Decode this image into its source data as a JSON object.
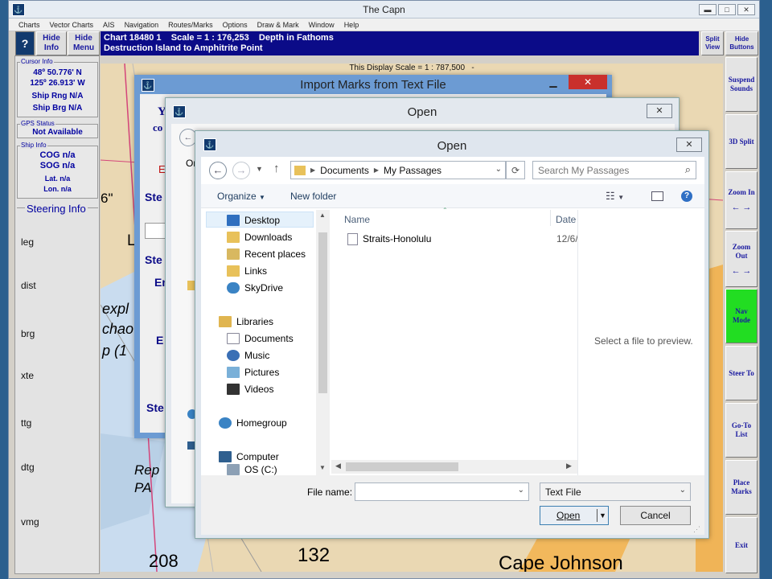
{
  "main_window": {
    "title": "The Capn",
    "menu": [
      "Charts",
      "Vector Charts",
      "AIS",
      "Navigation",
      "Routes/Marks",
      "Options",
      "Draw & Mark",
      "Window",
      "Help"
    ]
  },
  "toolbar": {
    "hide_info": "Hide Info",
    "hide_menu": "Hide Menu",
    "split_view": "Split View",
    "hide_buttons": "Hide Buttons"
  },
  "chart_info": {
    "line1": "Chart 18480 1    Scale = 1 : 176,253    Depth in Fathoms",
    "line2": "Destruction Island to Amphitrite Point"
  },
  "display_scale": "This Display Scale = 1 : 787,500   -",
  "cursor_info": {
    "caption": "Cursor Info",
    "lat": "48º 50.776' N",
    "lon": "125º 26.913' W",
    "ship_rng": "Ship Rng N/A",
    "ship_brg": "Ship Brg N/A"
  },
  "gps_status": {
    "caption": "GPS Status",
    "value": "Not Available"
  },
  "ship_info": {
    "caption": "Ship Info",
    "cog": "COG n/a",
    "sog": "SOG n/a",
    "lat": "Lat. n/a",
    "lon": "Lon. n/a"
  },
  "steering": {
    "title": "Steering Info",
    "labels": [
      "leg",
      "dist",
      "brg",
      "xte",
      "ttg",
      "dtg",
      "vmg"
    ]
  },
  "right_buttons": [
    "Suspend Sounds",
    "3D Split",
    "Zoom In",
    "Zoom Out",
    "Nav Mode",
    "Steer To",
    "Go-To List",
    "Place Marks",
    "Exit"
  ],
  "colors": {
    "nav_mode": "#22dd22",
    "dialog_accent": "#6c9bd3",
    "chart_header": "#0b0b88"
  },
  "import_dialog": {
    "title": "Import Marks from Text File",
    "partial_labels": [
      "Ste",
      "Ste",
      "En",
      "E",
      "Ste",
      "Y",
      "co",
      "E"
    ]
  },
  "open_back": {
    "title": "Open"
  },
  "open_dialog": {
    "title": "Open",
    "breadcrumb": [
      "Documents",
      "My Passages"
    ],
    "search_placeholder": "Search My Passages",
    "organize": "Organize",
    "new_folder": "New folder",
    "nav": {
      "favorites": [
        "Desktop",
        "Downloads",
        "Recent places",
        "Links",
        "SkyDrive"
      ],
      "libraries_label": "Libraries",
      "libraries": [
        "Documents",
        "Music",
        "Pictures",
        "Videos"
      ],
      "homegroup": "Homegroup",
      "computer": "Computer",
      "drive": "OS (C:)"
    },
    "columns": {
      "name": "Name",
      "date": "Date"
    },
    "files": [
      {
        "name": "Straits-Honolulu",
        "date": "12/6/"
      }
    ],
    "preview": "Select a file to preview.",
    "file_name_label": "File name:",
    "file_name_value": "",
    "file_type": "Text File",
    "open_button": "Open",
    "cancel_button": "Cancel"
  },
  "map_labels": [
    "6\"",
    "La",
    "expl",
    "chao",
    "p (1",
    "Rep",
    "PA",
    "208",
    "132",
    "Cape Johnson"
  ]
}
